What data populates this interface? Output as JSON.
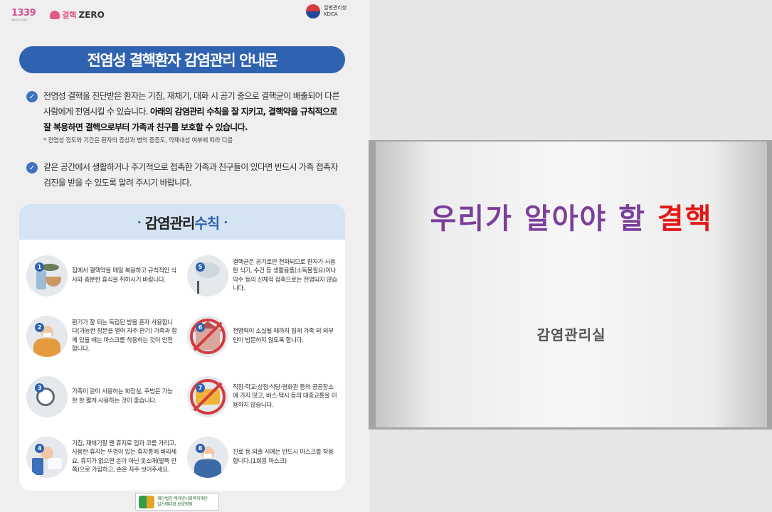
{
  "poster": {
    "logo_1339": "1339",
    "logo_1339_sub": "질병관리청 콜센터",
    "logo_zero_prefix": "결핵",
    "logo_zero_suffix": "ZERO",
    "kdca_line1": "질병관리청",
    "kdca_line2": "KDCA",
    "title": "전염성 결핵환자 감염관리 안내문",
    "bullet1_plain": "전염성 결핵을 진단받은 환자는 기침, 재채기, 대화 시 공기 중으로 결핵균이 배출되어 다른 사람에게 전염시킬 수 있습니다. ",
    "bullet1_bold": "아래의 감염관리 수칙을 잘 지키고, 결핵약을 규칙적으로 잘 복용하면 결핵으로부터 가족과 친구를 보호할 수 있습니다.",
    "bullet1_note": "* 전염성 정도와 기간은 환자의 증상과 병의 중증도, 약제내성 여부에 따라 다름",
    "bullet2": "같은 공간에서 생활하거나 주기적으로 접촉한 가족과 친구들이 있다면 반드시 가족 접촉자 검진을 받을 수 있도록 알려 주시기 바랍니다.",
    "rules_title_plain": "감염관리 ",
    "rules_title_blue": "수칙",
    "rules": [
      {
        "num": "1",
        "text": "집에서 결핵약을 매일 복용하고 규칙적인 식사와 충분한 휴식을 취하시기 바랍니다."
      },
      {
        "num": "5",
        "text": "결핵균은 공기로만 전파되므로 환자가 사용한 식기, 수건 등 생활용품(소독불필요)이나 악수 등의 신체적 접촉으로는 전염되지 않습니다."
      },
      {
        "num": "2",
        "text": "환기가 잘 되는 독립된 방을 혼자 사용합니다(가능한 창문을 열어 자주 환기) 가족과 함께 있을 때는 마스크를 착용하는 것이 안전합니다."
      },
      {
        "num": "6",
        "text": "전염력이 소실될 때까지 집에 가족 외 외부인이 방문하지 않도록 합니다."
      },
      {
        "num": "3",
        "text": "가족이 같이 사용하는 화장실, 주방은 가능한 한 짧게 사용하는 것이 좋습니다."
      },
      {
        "num": "7",
        "text": "직장·학교·상점·식당·영화관 등의 공공장소에 가지 않고, 버스·택시 등의 대중교통을 이용하지 않습니다."
      },
      {
        "num": "4",
        "text": "기침, 재채기할 땐 휴지로 입과 코를 가리고, 사용한 휴지는 뚜껑이 있는 휴지통에 버리세요. 휴지가 없으면 손이 아닌 옷소매(팔뚝 안쪽)으로 가림하고, 손은 자주 씻어주세요."
      },
      {
        "num": "8",
        "text": "진료 등 외출 시에는 반드시 마스크를 착용합니다.(1회용 마스크)"
      }
    ],
    "footer_line1": "재단법인 에이양사회복지재단",
    "footer_line2": "일산예디함 요양병원"
  },
  "slide": {
    "title_plain": "우리가 알아야 할 ",
    "title_red": "결핵",
    "subtitle": "감염관리실"
  },
  "colors": {
    "banner_blue": "#2f62b1",
    "title_purple": "#7b3f9a",
    "title_red": "#e41717"
  }
}
